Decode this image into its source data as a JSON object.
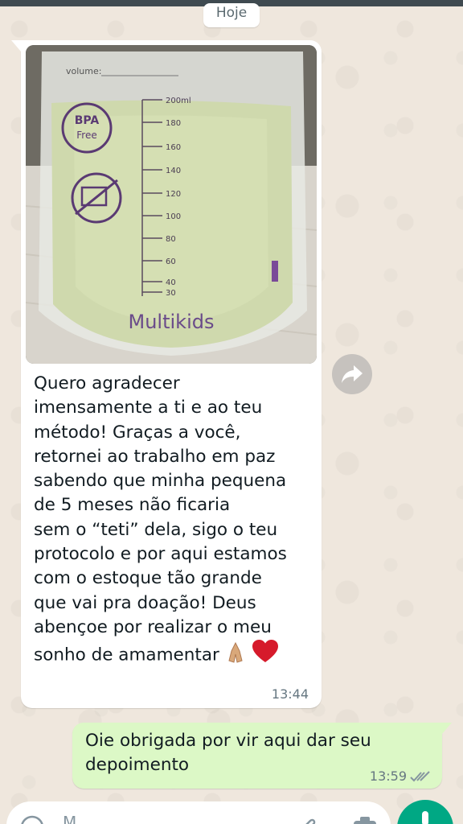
{
  "chat": {
    "date_label": "Hoje",
    "incoming": {
      "image": {
        "bag_volume_label": "volume:",
        "badge_line1": "BPA",
        "badge_line2": "Free",
        "scale_marks": [
          "200ml",
          "180",
          "160",
          "140",
          "120",
          "100",
          "80",
          "60",
          "40",
          "30"
        ],
        "brand": "Multikids"
      },
      "text": "Quero agradecer\nimensamente a ti e ao teu\nmétodo! Graças a você,\nretornei ao trabalho em paz\nsabendo que minha pequena\nde 5 meses não ficaria\nsem o “teti” dela, sigo o teu\nprotocolo e por aqui estamos\ncom o estoque tão grande\nque vai pra doação! Deus\nabençoe por realizar o meu\nsonho de amamentar",
      "time": "13:44"
    },
    "outgoing": {
      "text": "Oie obrigada por vir aqui dar seu\ndepoimento",
      "time": "13:59",
      "status_icon": "double-check-icon"
    }
  },
  "composer": {
    "placeholder": "M"
  },
  "colors": {
    "incoming_bubble": "#ffffff",
    "outgoing_bubble": "#dcf8c6",
    "mic_button": "#00a884",
    "chat_background": "#efe7dd"
  }
}
